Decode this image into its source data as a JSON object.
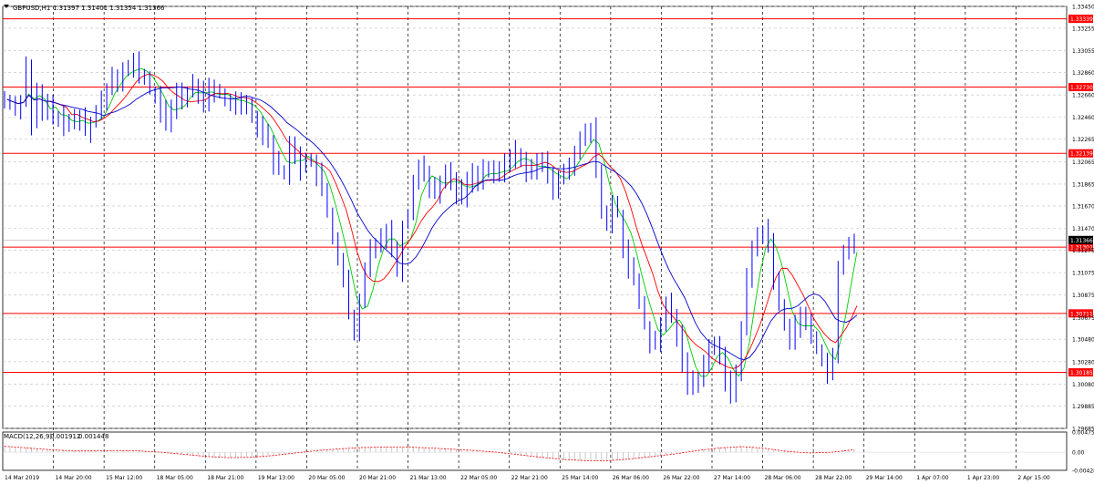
{
  "header": {
    "symbol_text": "GBPUSD,H1",
    "ohlc_text": "1.31397 1.31401 1.31354 1.31366"
  },
  "colors": {
    "candle": "#0000ff",
    "ma_fast": "#00cc00",
    "ma_mid": "#ff0000",
    "ma_slow": "#0000cc",
    "level_line": "#ff0000",
    "level_label_bg": "#ff0000",
    "price_label_bg": "#000000",
    "grid": "#c0c0c0",
    "macd_hist": "#c8c8c8",
    "macd_signal": "#ff0000"
  },
  "chart_data": {
    "type": "line",
    "subtype": "candlestick",
    "symbol": "GBPUSD",
    "timeframe": "H1",
    "ylim": [
      1.29685,
      1.3345
    ],
    "y_ticks": [
      "1.33450",
      "1.33255",
      "1.33055",
      "1.32860",
      "1.32660",
      "1.32460",
      "1.32265",
      "1.32065",
      "1.31865",
      "1.31670",
      "1.31470",
      "1.31275",
      "1.31075",
      "1.30875",
      "1.30675",
      "1.30480",
      "1.30280",
      "1.30080",
      "1.29885",
      "1.29685"
    ],
    "x_ticks": [
      "14 Mar 2019",
      "14 Mar 20:00",
      "15 Mar 12:00",
      "18 Mar 05:00",
      "18 Mar 21:00",
      "19 Mar 13:00",
      "20 Mar 05:00",
      "20 Mar 21:00",
      "21 Mar 13:00",
      "22 Mar 05:00",
      "22 Mar 21:00",
      "25 Mar 14:00",
      "26 Mar 06:00",
      "26 Mar 22:00",
      "27 Mar 14:00",
      "28 Mar 06:00",
      "28 Mar 22:00",
      "29 Mar 14:00",
      "1 Apr 07:00",
      "1 Apr 23:00",
      "2 Apr 15:00"
    ],
    "levels": [
      {
        "value": 1.33339,
        "label": "1.33339"
      },
      {
        "value": 1.3273,
        "label": "1.32730"
      },
      {
        "value": 1.32139,
        "label": "1.32139"
      },
      {
        "value": 1.31302,
        "label": "1.31302"
      },
      {
        "value": 1.30711,
        "label": "1.30711"
      },
      {
        "value": 1.30185,
        "label": "1.30185"
      }
    ],
    "current_price": {
      "value": 1.31366,
      "label": "1.31366"
    },
    "series": [
      {
        "name": "price",
        "values": [
          1.3262,
          1.3258,
          1.3255,
          1.3262,
          1.3292,
          1.324,
          1.3268,
          1.3248,
          1.3258,
          1.3247,
          1.3241,
          1.3245,
          1.324,
          1.3242,
          1.3246,
          1.3235,
          1.3242,
          1.325,
          1.3262,
          1.3272,
          1.3285,
          1.328,
          1.329,
          1.3288,
          1.3295,
          1.3285,
          1.328,
          1.327,
          1.3265,
          1.325,
          1.324,
          1.3255,
          1.327,
          1.326,
          1.3268,
          1.3275,
          1.3268,
          1.3262,
          1.327,
          1.3268,
          1.3266,
          1.3262,
          1.3258,
          1.326,
          1.3263,
          1.3255,
          1.3248,
          1.324,
          1.3232,
          1.3226,
          1.3205,
          1.32,
          1.3195,
          1.322,
          1.3215,
          1.32,
          1.321,
          1.3205,
          1.3195,
          1.318,
          1.316,
          1.314,
          1.312,
          1.31,
          1.307,
          1.305,
          1.308,
          1.311,
          1.313,
          1.3135,
          1.314,
          1.3145,
          1.313,
          1.311,
          1.315,
          1.316,
          1.319,
          1.3205,
          1.3195,
          1.3185,
          1.318,
          1.319,
          1.3195,
          1.319,
          1.318,
          1.3175,
          1.319,
          1.3195,
          1.3192,
          1.32,
          1.3196,
          1.3195,
          1.3198,
          1.3204,
          1.321,
          1.3215,
          1.3208,
          1.32,
          1.3195,
          1.3205,
          1.321,
          1.319,
          1.318,
          1.3195,
          1.32,
          1.3205,
          1.3215,
          1.3225,
          1.323,
          1.3235,
          1.32,
          1.316,
          1.315,
          1.317,
          1.316,
          1.313,
          1.311,
          1.31,
          1.308,
          1.306,
          1.3045,
          1.3042,
          1.306,
          1.308,
          1.307,
          1.305,
          1.303,
          1.301,
          1.3005,
          1.3015,
          1.303,
          1.304,
          1.3045,
          1.303,
          1.301,
          1.3,
          1.302,
          1.306,
          1.31,
          1.313,
          1.314,
          1.3145,
          1.3135,
          1.31,
          1.308,
          1.306,
          1.305,
          1.306,
          1.307,
          1.306,
          1.305,
          1.304,
          1.303,
          1.302,
          1.303,
          1.311,
          1.3125,
          1.3132,
          1.3137
        ]
      },
      {
        "name": "macd_signal",
        "values": [
          0.0014,
          0.001,
          0.0006,
          0.0003,
          0.0003,
          0.0004,
          0.0003,
          0.0,
          -0.0005,
          -0.001,
          -0.0013,
          -0.0012,
          -0.0008,
          -0.0002,
          0.0004,
          0.0008,
          0.0011,
          0.0012,
          0.0012,
          0.001,
          0.0007,
          0.0004,
          0.0,
          -0.0006,
          -0.0012,
          -0.0017,
          -0.002,
          -0.002,
          -0.0016,
          -0.001,
          -0.0004,
          0.0004,
          0.001,
          0.0013,
          0.0009,
          0.0002,
          -0.0002,
          0.0,
          0.0006
        ]
      }
    ],
    "macd": {
      "label": "MACD(12,26,9)",
      "main": "0.001912",
      "signal": "0.001448",
      "ylim": [
        -0.00428,
        0.00475
      ],
      "y_ticks": [
        "0.00475",
        "0.00",
        "-0.00428"
      ]
    },
    "grid": true
  }
}
